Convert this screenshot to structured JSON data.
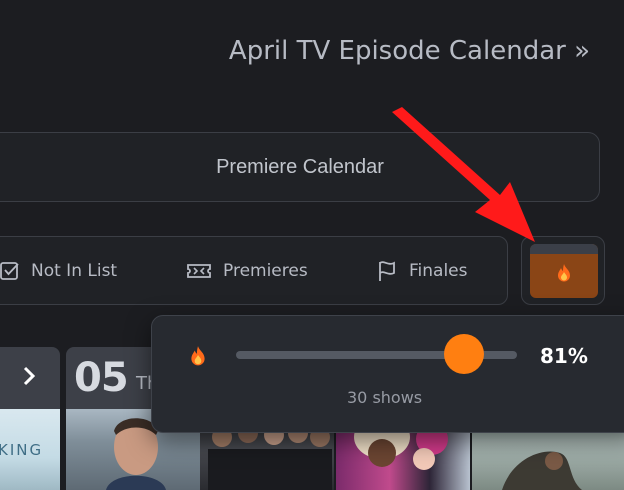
{
  "header": {
    "calendar_link": "April TV Episode Calendar »"
  },
  "premiere_button": {
    "label": "Premiere Calendar"
  },
  "filters": {
    "not_in_list": "Not In List",
    "premieres": "Premieres",
    "finales": "Finales"
  },
  "heat_toggle": {
    "icon": "flame-icon",
    "accent": "#8a4516"
  },
  "calendar": {
    "day_number": "05",
    "weekday_partial": "Th",
    "poster_text": "KING"
  },
  "heat_popover": {
    "slider_percent": 81,
    "value_label": "81%",
    "shows_label": "30 shows",
    "thumb_color": "#ff7f11"
  },
  "annotation": {
    "arrow_color": "#ff1a1a"
  }
}
